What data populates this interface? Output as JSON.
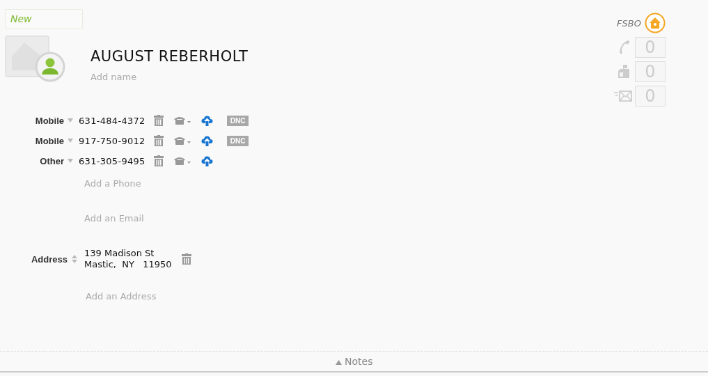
{
  "status_field": {
    "value": "New"
  },
  "contact": {
    "name": "AUGUST REBERHOLT",
    "add_name": "Add name"
  },
  "flags": {
    "label": "FSBO"
  },
  "counters": [
    {
      "kind": "call",
      "value": "0"
    },
    {
      "kind": "mail",
      "value": "0"
    },
    {
      "kind": "email",
      "value": "0"
    }
  ],
  "phones": [
    {
      "type": "Mobile",
      "number": "631-484-4372",
      "badge": "DNC"
    },
    {
      "type": "Mobile",
      "number": "917-750-9012",
      "badge": "DNC"
    },
    {
      "type": "Other",
      "number": "631-305-9495"
    }
  ],
  "add_phone": "Add a Phone",
  "add_email": "Add an Email",
  "address": {
    "label": "Address",
    "line1": "139 Madison St",
    "line2": "Mastic,  NY   11950"
  },
  "add_address": "Add an Address",
  "notes": {
    "label": "Notes",
    "expanded": false
  }
}
